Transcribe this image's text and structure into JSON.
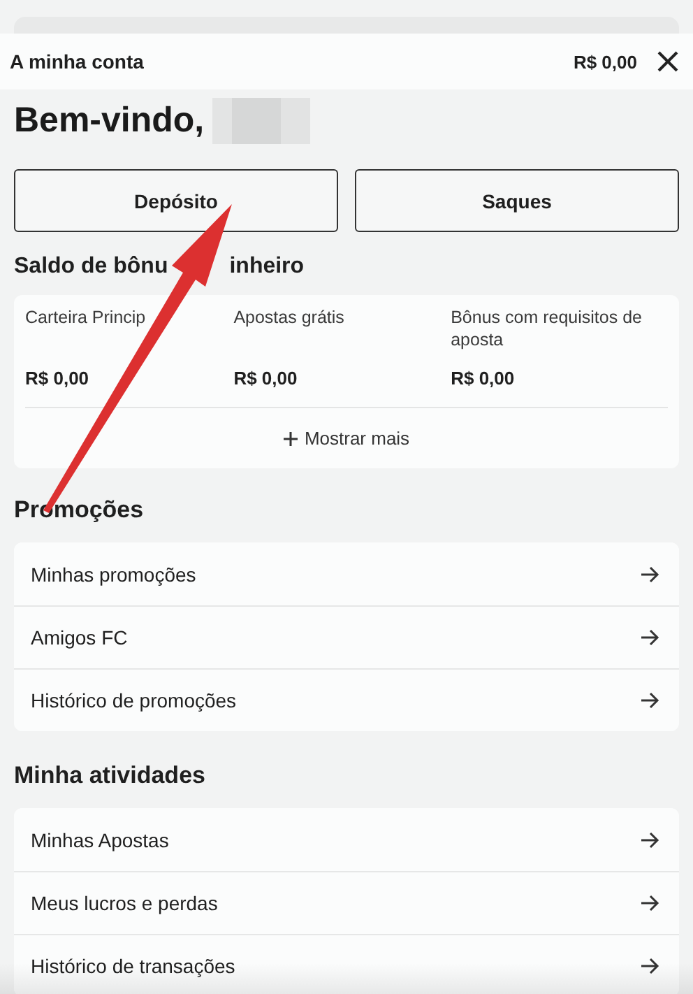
{
  "header": {
    "title": "A minha conta",
    "balance": "R$ 0,00"
  },
  "welcome": {
    "greeting": "Bem-vindo,"
  },
  "actions": [
    {
      "label": "Depósito"
    },
    {
      "label": "Saques"
    }
  ],
  "balance_section": {
    "title_parts": [
      "Saldo de bônu",
      "inheiro"
    ],
    "wallets": [
      {
        "label": "Carteira Princip",
        "amount": "R$ 0,00"
      },
      {
        "label": "Apostas grátis",
        "amount": "R$ 0,00"
      },
      {
        "label": "Bônus com requisitos de aposta",
        "amount": "R$ 0,00"
      }
    ],
    "show_more": "Mostrar mais"
  },
  "sections": [
    {
      "title": "Promoções",
      "items": [
        "Minhas promoções",
        "Amigos FC",
        "Histórico de promoções"
      ]
    },
    {
      "title": "Minha atividades",
      "items": [
        "Minhas Apostas",
        "Meus lucros e perdas",
        "Histórico de transações"
      ]
    }
  ]
}
